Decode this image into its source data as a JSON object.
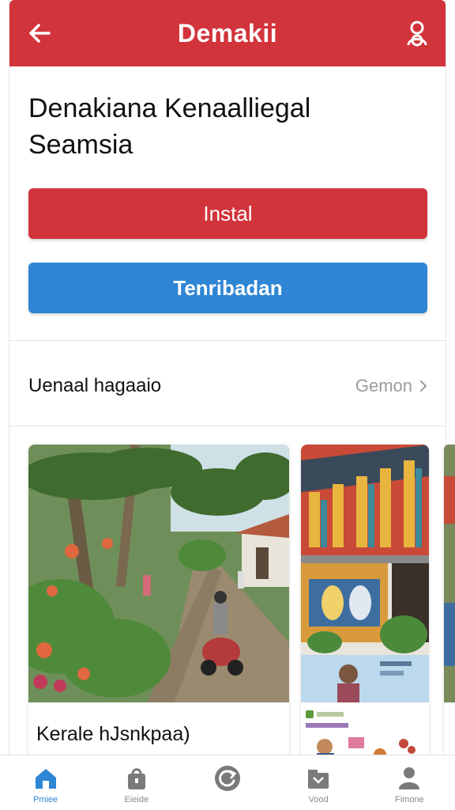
{
  "header": {
    "title": "Demakii",
    "back_icon": "arrow-left-icon",
    "profile_icon": "user-icon",
    "color": "#d2343b"
  },
  "headline": {
    "line1": "Denakiana Kenaalliegal",
    "line2": "Seamsia"
  },
  "actions": {
    "install_label": "Instal",
    "secondary_label": "Tenribadan",
    "install_color": "#d2343b",
    "secondary_color": "#2f86d4"
  },
  "section": {
    "title": "Uenaal hagaaio",
    "link_label": "Gemon"
  },
  "cards": [
    {
      "caption": "Kerale hJsnkpaa)"
    }
  ],
  "bottom_nav": {
    "items": [
      {
        "label": "Pmiee",
        "icon": "home-icon",
        "active": true
      },
      {
        "label": "Eieide",
        "icon": "bag-icon",
        "active": false
      },
      {
        "label": "",
        "icon": "refresh-icon",
        "active": false
      },
      {
        "label": "Vood",
        "icon": "box-icon",
        "active": false
      },
      {
        "label": "Fimone",
        "icon": "person-icon",
        "active": false
      }
    ]
  }
}
